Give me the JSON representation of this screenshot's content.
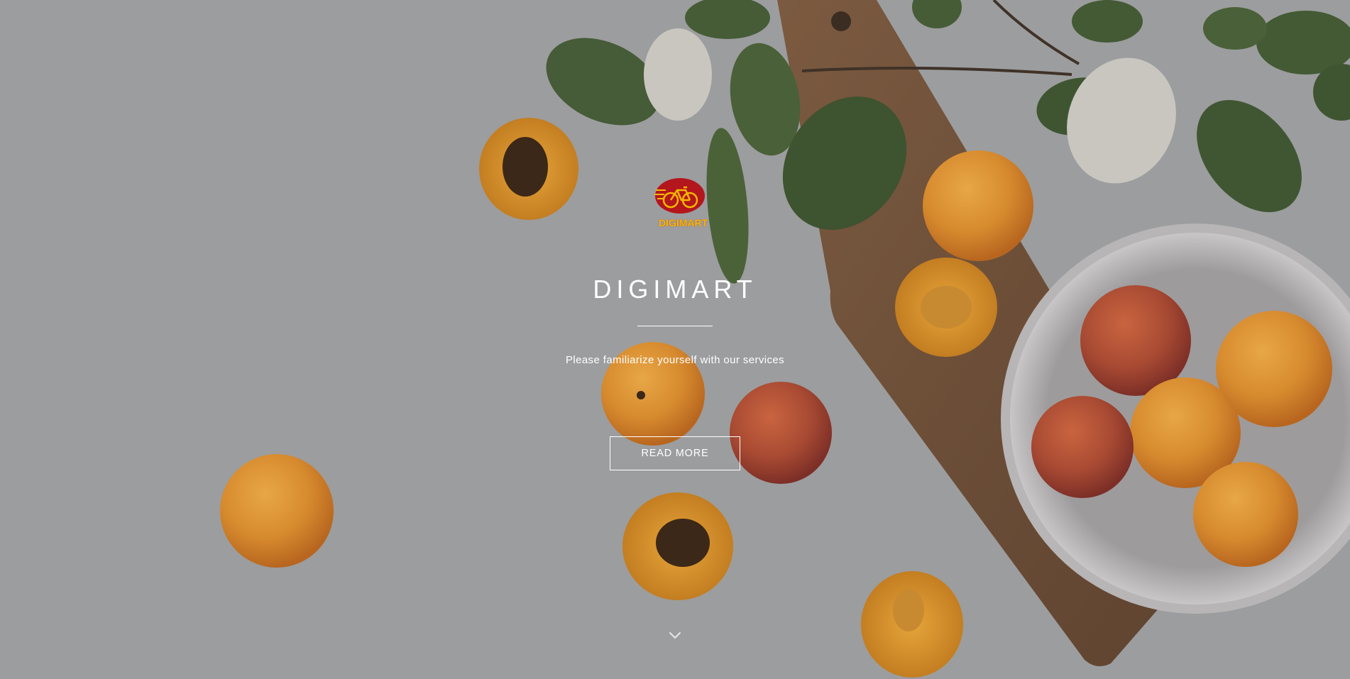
{
  "hero": {
    "logo_text": "DIGIMART",
    "title": "DIGIMART",
    "subtitle": "Please familiarize yourself with our services",
    "read_more_label": "READ MORE",
    "scroll_icon": "chevron-down-icon"
  },
  "colors": {
    "text": "#ffffff",
    "logo_red": "#b3161c",
    "logo_yellow": "#f5b800",
    "background_surface": "#9a9b9c"
  }
}
